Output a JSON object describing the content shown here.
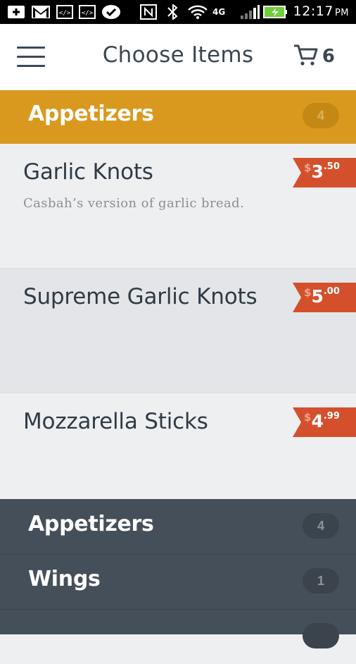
{
  "status_bar": {
    "time": "12:17",
    "ampm": "PM",
    "icons": [
      "add-icon",
      "gmail-icon",
      "code-icon",
      "code-icon",
      "check-icon",
      "nfc-icon",
      "bluetooth-icon",
      "wifi-icon",
      "4g-lte-icon",
      "signal-icon",
      "battery-charging-icon"
    ],
    "network_label": "4G"
  },
  "app_bar": {
    "title": "Choose Items",
    "cart_count": "6"
  },
  "category": {
    "title": "Appetizers",
    "count": "4"
  },
  "items": [
    {
      "name": "Garlic Knots",
      "description": "Casbah’s version of garlic bread.",
      "currency": "$",
      "dollars": "3",
      "cents": ".50"
    },
    {
      "name": "Supreme Garlic Knots",
      "description": "",
      "currency": "$",
      "dollars": "5",
      "cents": ".00"
    },
    {
      "name": "Mozzarella Sticks",
      "description": "",
      "currency": "$",
      "dollars": "4",
      "cents": ".99"
    }
  ],
  "drawer": [
    {
      "label": "Appetizers",
      "count": "4"
    },
    {
      "label": "Wings",
      "count": "1"
    },
    {
      "label": "",
      "count": ""
    }
  ],
  "colors": {
    "accent": "#d9991f",
    "price_tag": "#d4502c",
    "drawer_bg": "#454f59",
    "text_dark": "#2f3b46"
  }
}
